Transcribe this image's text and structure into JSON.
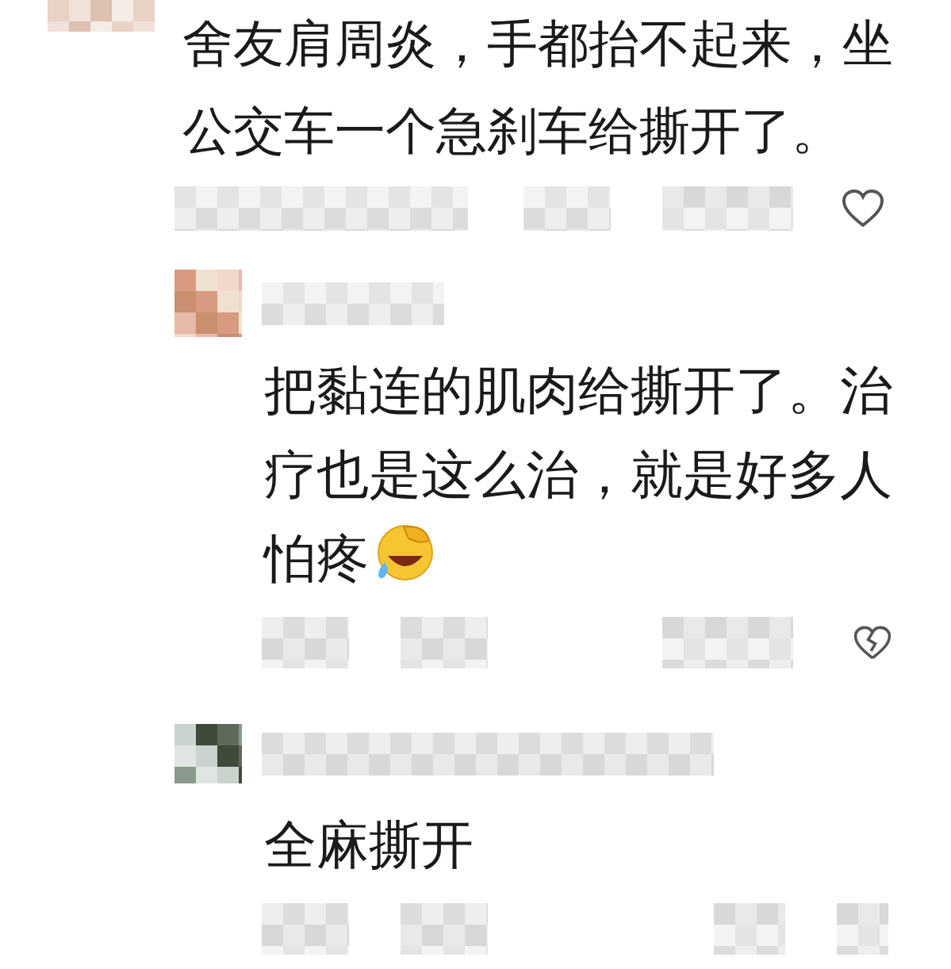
{
  "comments": [
    {
      "kind": "top",
      "text": "舍友肩周炎，手都抬不起来，坐公交车一个急刹车给撕开了。",
      "reaction": {
        "kind": "heart"
      }
    },
    {
      "kind": "reply",
      "text": "把黏连的肌肉给撕开了。治疗也是这么治，就是好多人怕疼",
      "emoji": {
        "kind": "laughing"
      },
      "reaction": {
        "kind": "broken_heart"
      }
    },
    {
      "kind": "reply",
      "text": "全麻撕开",
      "reaction": {
        "kind": "hidden"
      }
    }
  ]
}
